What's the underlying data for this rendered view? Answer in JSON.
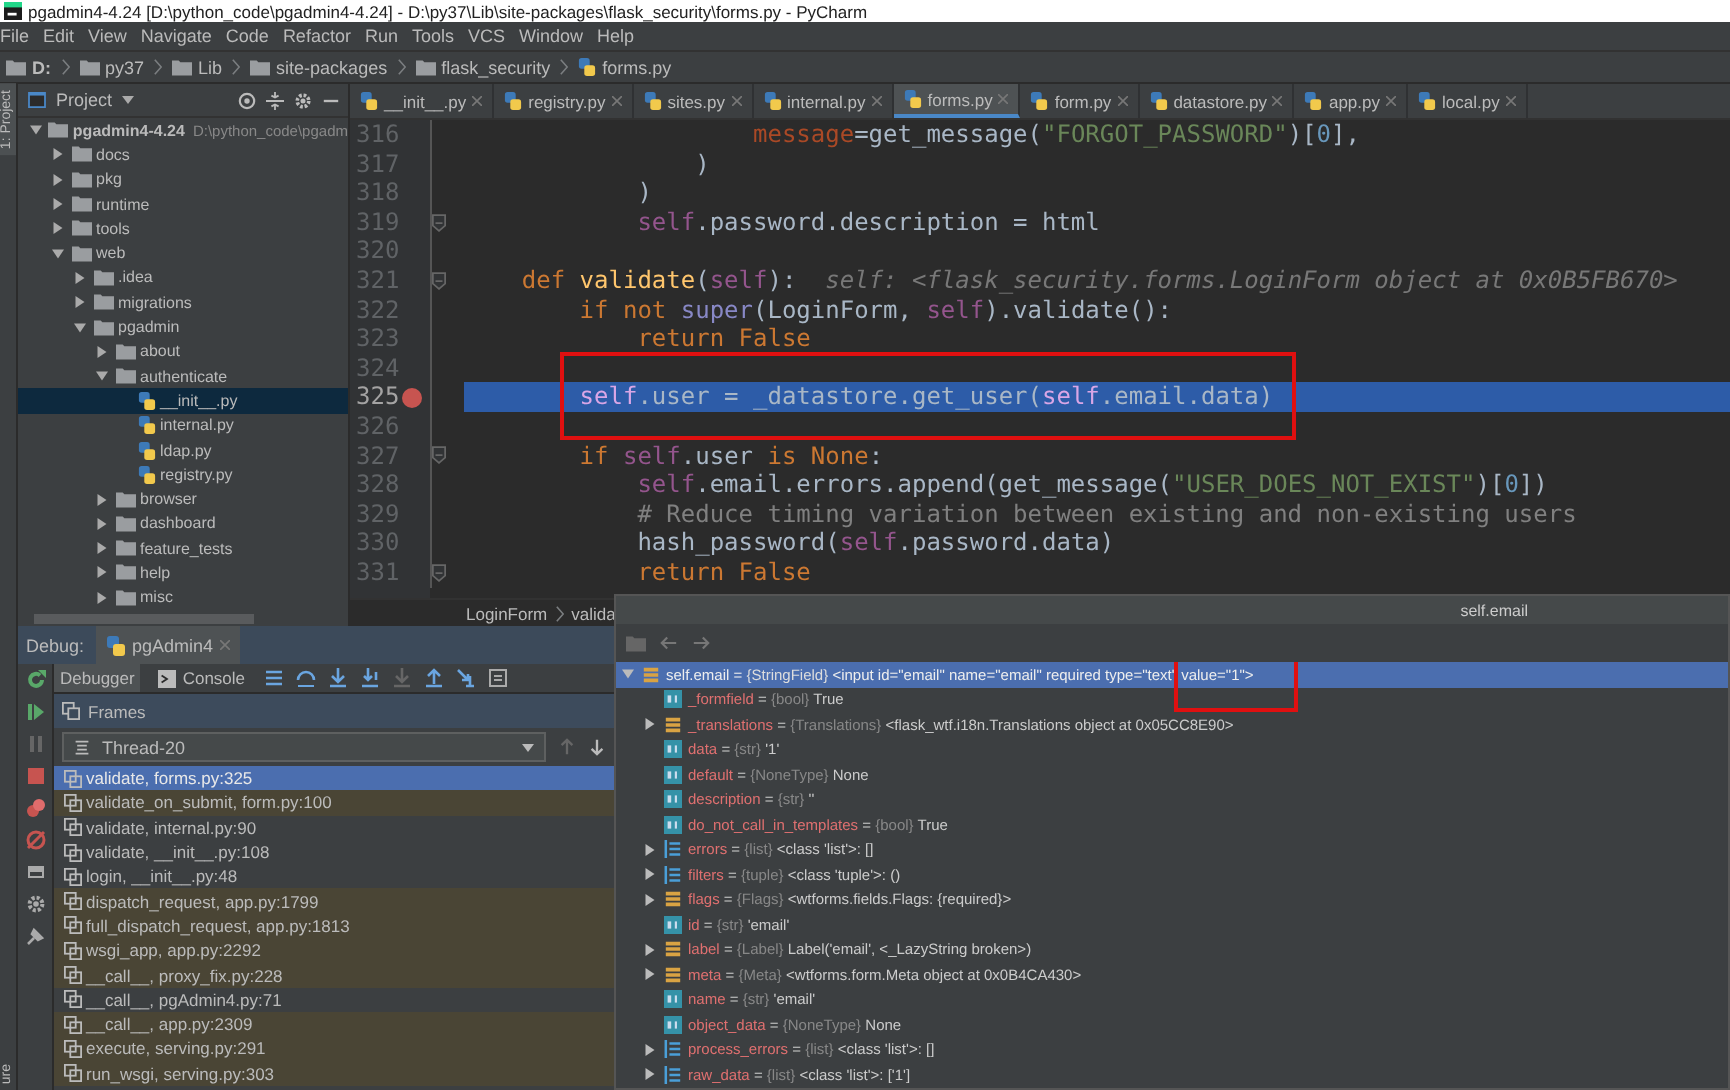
{
  "window": {
    "title": "pgadmin4-4.24 [D:\\python_code\\pgadmin4-4.24] - D:\\py37\\Lib\\site-packages\\flask_security\\forms.py - PyCharm"
  },
  "menu": [
    "File",
    "Edit",
    "View",
    "Navigate",
    "Code",
    "Refactor",
    "Run",
    "Tools",
    "VCS",
    "Window",
    "Help"
  ],
  "breadcrumbs": [
    {
      "label": "D:",
      "kind": "drive"
    },
    {
      "label": "py37",
      "kind": "folder"
    },
    {
      "label": "Lib",
      "kind": "folder"
    },
    {
      "label": "site-packages",
      "kind": "folder"
    },
    {
      "label": "flask_security",
      "kind": "folder"
    },
    {
      "label": "forms.py",
      "kind": "file"
    }
  ],
  "tool_windows": [
    "1: Project",
    "ure"
  ],
  "project": {
    "title": "Project",
    "tree": [
      {
        "label": "pgadmin4-4.24",
        "path": "D:\\python_code\\pgadm",
        "kind": "folder",
        "expanded": true,
        "selected": false,
        "children": [
          {
            "label": "docs",
            "kind": "folder",
            "expanded": false,
            "selected": false
          },
          {
            "label": "pkg",
            "kind": "folder",
            "expanded": false,
            "selected": false
          },
          {
            "label": "runtime",
            "kind": "folder",
            "expanded": false,
            "selected": false
          },
          {
            "label": "tools",
            "kind": "folder",
            "expanded": false,
            "selected": false
          },
          {
            "label": "web",
            "kind": "folder",
            "expanded": true,
            "selected": false,
            "children": [
              {
                "label": ".idea",
                "kind": "folder",
                "expanded": false,
                "selected": false
              },
              {
                "label": "migrations",
                "kind": "folder",
                "expanded": false,
                "selected": false
              },
              {
                "label": "pgadmin",
                "kind": "folder",
                "expanded": true,
                "selected": false,
                "children": [
                  {
                    "label": "about",
                    "kind": "folder",
                    "expanded": false,
                    "selected": false
                  },
                  {
                    "label": "authenticate",
                    "kind": "folder",
                    "expanded": true,
                    "selected": false,
                    "children": [
                      {
                        "label": "__init__.py",
                        "kind": "file",
                        "selected": true
                      },
                      {
                        "label": "internal.py",
                        "kind": "file",
                        "selected": false
                      },
                      {
                        "label": "ldap.py",
                        "kind": "file",
                        "selected": false
                      },
                      {
                        "label": "registry.py",
                        "kind": "file",
                        "selected": false
                      }
                    ]
                  },
                  {
                    "label": "browser",
                    "kind": "folder",
                    "expanded": false,
                    "selected": false
                  },
                  {
                    "label": "dashboard",
                    "kind": "folder",
                    "expanded": false,
                    "selected": false
                  },
                  {
                    "label": "feature_tests",
                    "kind": "folder",
                    "expanded": false,
                    "selected": false
                  },
                  {
                    "label": "help",
                    "kind": "folder",
                    "expanded": false,
                    "selected": false
                  },
                  {
                    "label": "misc",
                    "kind": "folder",
                    "expanded": false,
                    "selected": false
                  }
                ]
              }
            ]
          }
        ]
      }
    ]
  },
  "editor": {
    "tabs": [
      {
        "label": "__init__.py",
        "selected": false
      },
      {
        "label": "registry.py",
        "selected": false
      },
      {
        "label": "sites.py",
        "selected": false
      },
      {
        "label": "internal.py",
        "selected": false
      },
      {
        "label": "forms.py",
        "selected": true
      },
      {
        "label": "form.py",
        "selected": false
      },
      {
        "label": "datastore.py",
        "selected": false
      },
      {
        "label": "app.py",
        "selected": false
      },
      {
        "label": "local.py",
        "selected": false
      }
    ],
    "lines": [
      {
        "number": "316",
        "current": false,
        "breakpoint": false,
        "fold": false,
        "tokens": [
          {
            "text": "                    message",
            "kind": "param"
          },
          {
            "text": "=get_message(",
            "kind": "plain"
          },
          {
            "text": "\"FORGOT_PASSWORD\"",
            "kind": "str"
          },
          {
            "text": ")[",
            "kind": "plain"
          },
          {
            "text": "0",
            "kind": "num"
          },
          {
            "text": "],",
            "kind": "plain"
          }
        ]
      },
      {
        "number": "317",
        "current": false,
        "breakpoint": false,
        "fold": false,
        "tokens": [
          {
            "text": "                )",
            "kind": "plain"
          }
        ]
      },
      {
        "number": "318",
        "current": false,
        "breakpoint": false,
        "fold": false,
        "tokens": [
          {
            "text": "            )",
            "kind": "plain"
          }
        ]
      },
      {
        "number": "319",
        "current": false,
        "breakpoint": false,
        "fold": true,
        "tokens": [
          {
            "text": "            self",
            "kind": "self"
          },
          {
            "text": ".password.description = html",
            "kind": "plain"
          }
        ]
      },
      {
        "number": "320",
        "current": false,
        "breakpoint": false,
        "fold": false
      },
      {
        "number": "321",
        "current": false,
        "breakpoint": false,
        "fold": true,
        "tokens": [
          {
            "text": "    def ",
            "kind": "kw"
          },
          {
            "text": "validate",
            "kind": "fn"
          },
          {
            "text": "(",
            "kind": "plain"
          },
          {
            "text": "self",
            "kind": "self"
          },
          {
            "text": "):  ",
            "kind": "plain"
          },
          {
            "text": "self: <flask_security.forms.LoginForm object at 0x0B5FB670>",
            "kind": "hint"
          }
        ]
      },
      {
        "number": "322",
        "current": false,
        "breakpoint": false,
        "fold": false,
        "tokens": [
          {
            "text": "        if not ",
            "kind": "kw"
          },
          {
            "text": "super",
            "kind": "builtin"
          },
          {
            "text": "(LoginForm, ",
            "kind": "plain"
          },
          {
            "text": "self",
            "kind": "self"
          },
          {
            "text": ").validate():",
            "kind": "plain"
          }
        ]
      },
      {
        "number": "323",
        "current": false,
        "breakpoint": false,
        "fold": false,
        "tokens": [
          {
            "text": "            return False",
            "kind": "kw"
          }
        ]
      },
      {
        "number": "324",
        "current": false,
        "breakpoint": false,
        "fold": false
      },
      {
        "number": "325",
        "current": true,
        "breakpoint": true,
        "fold": false,
        "tokens": [
          {
            "text": "        self",
            "kind": "self"
          },
          {
            "text": ".user = _datastore.get_user(",
            "kind": "plain"
          },
          {
            "text": "self",
            "kind": "self"
          },
          {
            "text": ".email.data)",
            "kind": "plain"
          }
        ]
      },
      {
        "number": "326",
        "current": false,
        "breakpoint": false,
        "fold": false
      },
      {
        "number": "327",
        "current": false,
        "breakpoint": false,
        "fold": true,
        "tokens": [
          {
            "text": "        if ",
            "kind": "kw"
          },
          {
            "text": "self",
            "kind": "self"
          },
          {
            "text": ".user ",
            "kind": "plain"
          },
          {
            "text": "is None",
            "kind": "kw"
          },
          {
            "text": ":",
            "kind": "plain"
          }
        ]
      },
      {
        "number": "328",
        "current": false,
        "breakpoint": false,
        "fold": false,
        "tokens": [
          {
            "text": "            self",
            "kind": "self"
          },
          {
            "text": ".email.errors.append(get_message(",
            "kind": "plain"
          },
          {
            "text": "\"USER_DOES_NOT_EXIST\"",
            "kind": "str"
          },
          {
            "text": ")[",
            "kind": "plain"
          },
          {
            "text": "0",
            "kind": "num"
          },
          {
            "text": "])",
            "kind": "plain"
          }
        ]
      },
      {
        "number": "329",
        "current": false,
        "breakpoint": false,
        "fold": false,
        "tokens": [
          {
            "text": "            # Reduce timing variation between existing and non-existing users",
            "kind": "comment"
          }
        ]
      },
      {
        "number": "330",
        "current": false,
        "breakpoint": false,
        "fold": false,
        "tokens": [
          {
            "text": "            hash_password(",
            "kind": "plain"
          },
          {
            "text": "self",
            "kind": "self"
          },
          {
            "text": ".password.data)",
            "kind": "plain"
          }
        ]
      },
      {
        "number": "331",
        "current": false,
        "breakpoint": false,
        "fold": true,
        "tokens": [
          {
            "text": "            return False",
            "kind": "kw"
          }
        ]
      }
    ],
    "breadcrumb": [
      "LoginForm",
      "valida"
    ]
  },
  "debug": {
    "label": "Debug:",
    "session": "pgAdmin4",
    "tabs": [
      {
        "label": "Debugger",
        "selected": true
      },
      {
        "label": "Console",
        "selected": false
      }
    ],
    "frames_title": "Frames",
    "thread": "Thread-20",
    "frames": [
      {
        "label": "validate, forms.py:325",
        "library": false,
        "selected": true
      },
      {
        "label": "validate_on_submit, form.py:100",
        "library": true,
        "selected": false
      },
      {
        "label": "validate, internal.py:90",
        "library": false,
        "selected": false
      },
      {
        "label": "validate, __init__.py:108",
        "library": false,
        "selected": false
      },
      {
        "label": "login, __init__.py:48",
        "library": false,
        "selected": false
      },
      {
        "label": "dispatch_request, app.py:1799",
        "library": true,
        "selected": false
      },
      {
        "label": "full_dispatch_request, app.py:1813",
        "library": true,
        "selected": false
      },
      {
        "label": "wsgi_app, app.py:2292",
        "library": true,
        "selected": false
      },
      {
        "label": "__call__, proxy_fix.py:228",
        "library": true,
        "selected": false
      },
      {
        "label": "__call__, pgAdmin4.py:71",
        "library": false,
        "selected": false
      },
      {
        "label": "__call__, app.py:2309",
        "library": true,
        "selected": false
      },
      {
        "label": "execute, serving.py:291",
        "library": true,
        "selected": false
      },
      {
        "label": "run_wsgi, serving.py:303",
        "library": true,
        "selected": false
      }
    ]
  },
  "popup": {
    "title": "self.email",
    "root": {
      "name": "self.email",
      "equals": "=",
      "type": "{StringField}",
      "value": "<input id=\"email\" name=\"email\" required type=\"text\" value=\"1\">",
      "kind": "object",
      "expanded": true,
      "selected": true,
      "children": [
        {
          "name": "_formfield",
          "equals": "=",
          "type": "{bool}",
          "value": "True",
          "kind": "primitive",
          "expandable": false,
          "selected": false
        },
        {
          "name": "_translations",
          "equals": "=",
          "type": "{Translations}",
          "value": "<flask_wtf.i18n.Translations object at 0x05CC8E90>",
          "kind": "object",
          "expandable": true,
          "selected": false
        },
        {
          "name": "data",
          "equals": "=",
          "type": "{str}",
          "value": "'1'",
          "kind": "primitive",
          "expandable": false,
          "selected": false
        },
        {
          "name": "default",
          "equals": "=",
          "type": "{NoneType}",
          "value": "None",
          "kind": "primitive",
          "expandable": false,
          "selected": false
        },
        {
          "name": "description",
          "equals": "=",
          "type": "{str}",
          "value": "''",
          "kind": "primitive",
          "expandable": false,
          "selected": false
        },
        {
          "name": "do_not_call_in_templates",
          "equals": "=",
          "type": "{bool}",
          "value": "True",
          "kind": "primitive",
          "expandable": false,
          "selected": false
        },
        {
          "name": "errors",
          "equals": "=",
          "type": "{list}",
          "value": "<class 'list'>: []",
          "kind": "list",
          "expandable": true,
          "selected": false
        },
        {
          "name": "filters",
          "equals": "=",
          "type": "{tuple}",
          "value": "<class 'tuple'>: ()",
          "kind": "list",
          "expandable": true,
          "selected": false
        },
        {
          "name": "flags",
          "equals": "=",
          "type": "{Flags}",
          "value": "<wtforms.fields.Flags: {required}>",
          "kind": "object",
          "expandable": true,
          "selected": false
        },
        {
          "name": "id",
          "equals": "=",
          "type": "{str}",
          "value": "'email'",
          "kind": "primitive",
          "expandable": false,
          "selected": false
        },
        {
          "name": "label",
          "equals": "=",
          "type": "{Label}",
          "value": "Label('email', <_LazyString broken>)",
          "kind": "object",
          "expandable": true,
          "selected": false
        },
        {
          "name": "meta",
          "equals": "=",
          "type": "{Meta}",
          "value": "<wtforms.form.Meta object at 0x0B4CA430>",
          "kind": "object",
          "expandable": true,
          "selected": false
        },
        {
          "name": "name",
          "equals": "=",
          "type": "{str}",
          "value": "'email'",
          "kind": "primitive",
          "expandable": false,
          "selected": false
        },
        {
          "name": "object_data",
          "equals": "=",
          "type": "{NoneType}",
          "value": "None",
          "kind": "primitive",
          "expandable": false,
          "selected": false
        },
        {
          "name": "process_errors",
          "equals": "=",
          "type": "{list}",
          "value": "<class 'list'>: []",
          "kind": "list",
          "expandable": true,
          "selected": false
        },
        {
          "name": "raw_data",
          "equals": "=",
          "type": "{list}",
          "value": "<class 'list'>: ['1']",
          "kind": "list",
          "expandable": true,
          "selected": false
        }
      ]
    }
  }
}
